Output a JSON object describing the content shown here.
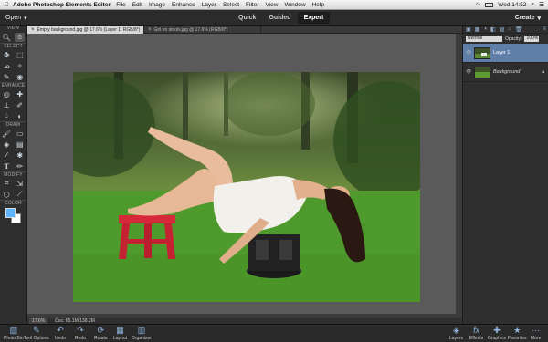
{
  "menubar": {
    "app": "Adobe Photoshop Elements Editor",
    "menus": [
      "File",
      "Edit",
      "Image",
      "Enhance",
      "Layer",
      "Select",
      "Filter",
      "View",
      "Window",
      "Help"
    ],
    "clock": "Wed 14:52"
  },
  "modebar": {
    "open": "Open",
    "tabs": [
      "Quick",
      "Guided",
      "Expert"
    ],
    "create": "Create"
  },
  "toolbox": {
    "sections": [
      "VIEW",
      "SELECT",
      "ENHANCE",
      "DRAW",
      "MODIFY",
      "COLOR"
    ]
  },
  "docs": [
    "Empty background.jpg @ 17.6% (Layer 1, RGB/8*)",
    "Girl on stools.jpg @ 17.6% (RGB/8*)"
  ],
  "status": {
    "zoom": "17.6%",
    "doc": "Doc: 65.1M/138.2M"
  },
  "layers": {
    "blend_mode": "Normal",
    "opacity_label": "Opacity:",
    "opacity_value": "100%",
    "items": [
      "Layer 1",
      "Background"
    ]
  },
  "taskbar": {
    "left": [
      "Photo Bin",
      "Tool Options",
      "Undo",
      "Redo",
      "Rotate",
      "Layout",
      "Organizer"
    ],
    "right": [
      "Layers",
      "Effects",
      "Graphics",
      "Favorites",
      "More"
    ]
  }
}
